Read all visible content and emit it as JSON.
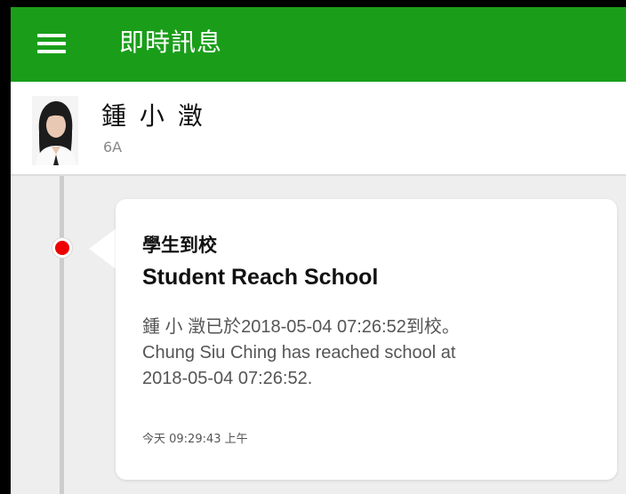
{
  "app_bar": {
    "title": "即時訊息",
    "menu_icon": "hamburger-menu-icon",
    "background_color": "#1a9e1a"
  },
  "student": {
    "name": "鍾 小 澂",
    "class": "6A"
  },
  "message": {
    "title_zh": "學生到校",
    "title_en": "Student Reach School",
    "body_lines": [
      "鍾 小 澂已於2018-05-04 07:26:52到校。",
      "Chung Siu Ching has reached school at",
      "2018-05-04 07:26:52."
    ],
    "timestamp": "今天 09:29:43 上午",
    "indicator_color": "#ee0000"
  }
}
